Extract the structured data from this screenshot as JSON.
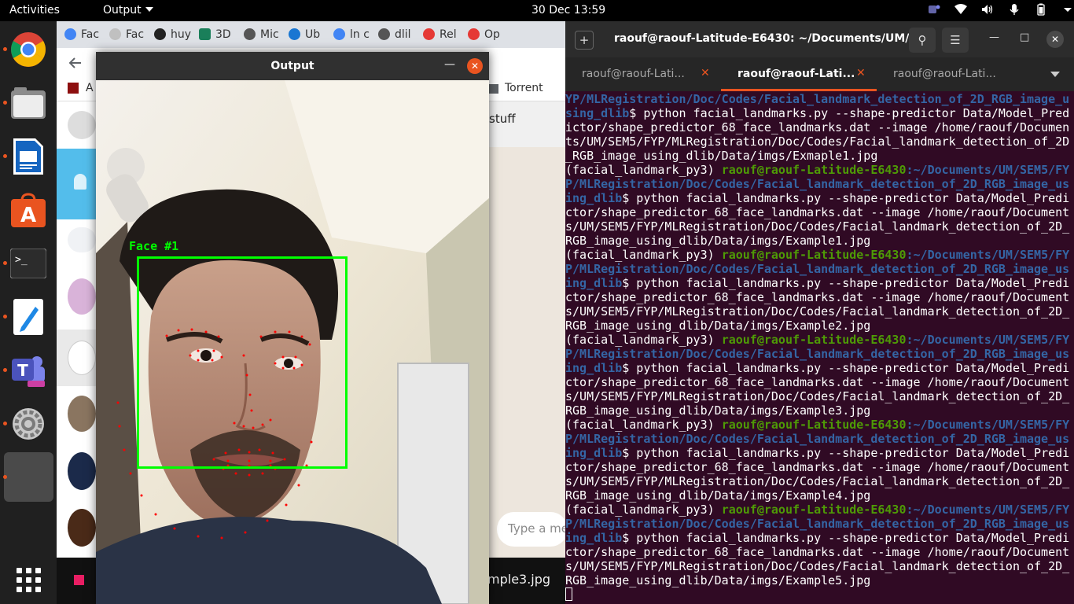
{
  "topbar": {
    "activities": "Activities",
    "app_menu": "Output",
    "clock": "30 Dec  13:59"
  },
  "dock": {
    "items": [
      "chrome-icon",
      "files-icon",
      "writer-icon",
      "software-icon",
      "terminal-icon",
      "teams-icon",
      "text-editor-icon",
      "settings-icon",
      "window-placeholder",
      "apps-grid-icon"
    ]
  },
  "browser": {
    "tabs": [
      "Fac",
      "Fac",
      "huy",
      "3D",
      "Mic",
      "Ub",
      "ln c",
      "dlil",
      "Rel",
      "Op"
    ],
    "bookmark_label": "Torrent",
    "bookmark_left": "A",
    "chat_header_text": "stuff",
    "message_placeholder": "Type a mes",
    "download_name": "mple3.jpg"
  },
  "output_window": {
    "title": "Output",
    "face_label": "Face #1"
  },
  "terminal": {
    "title": "raouf@raouf-Latitude-E6430: ~/Documents/UM/...",
    "tabs": [
      "raouf@raouf-Lati...",
      "raouf@raouf-Lati...",
      "raouf@raouf-Lati..."
    ],
    "lines": [
      {
        "path_cont": "YP/MLRegistration/Doc/Codes/Facial_landmark_detection_of_2D_RGB_image_using_dlib",
        "cmd": "$ python facial_landmarks.py --shape-predictor Data/Model_Predictor/shape_predictor_68_face_landmarks.dat --image /home/raouf/Documents/UM/SEM5/FYP/MLRegistration/Doc/Codes/Facial_landmark_detection_of_2D_RGB_image_using_dlib/Data/imgs/Exmaple1.jpg"
      },
      {
        "env": "(facial_landmark_py3) ",
        "user": "raouf@raouf-Latitude-E6430",
        "path": ":~/Documents/UM/SEM5/FYP/MLRegistration/Doc/Codes/Facial_landmark_detection_of_2D_RGB_image_using_dlib",
        "cmd": "$ python facial_landmarks.py --shape-predictor Data/Model_Predictor/shape_predictor_68_face_landmarks.dat --image /home/raouf/Documents/UM/SEM5/FYP/MLRegistration/Doc/Codes/Facial_landmark_detection_of_2D_RGB_image_using_dlib/Data/imgs/Example1.jpg"
      },
      {
        "env": "(facial_landmark_py3) ",
        "user": "raouf@raouf-Latitude-E6430",
        "path": ":~/Documents/UM/SEM5/FYP/MLRegistration/Doc/Codes/Facial_landmark_detection_of_2D_RGB_image_using_dlib",
        "cmd": "$ python facial_landmarks.py --shape-predictor Data/Model_Predictor/shape_predictor_68_face_landmarks.dat --image /home/raouf/Documents/UM/SEM5/FYP/MLRegistration/Doc/Codes/Facial_landmark_detection_of_2D_RGB_image_using_dlib/Data/imgs/Example2.jpg"
      },
      {
        "env": "(facial_landmark_py3) ",
        "user": "raouf@raouf-Latitude-E6430",
        "path": ":~/Documents/UM/SEM5/FYP/MLRegistration/Doc/Codes/Facial_landmark_detection_of_2D_RGB_image_using_dlib",
        "cmd": "$ python facial_landmarks.py --shape-predictor Data/Model_Predictor/shape_predictor_68_face_landmarks.dat --image /home/raouf/Documents/UM/SEM5/FYP/MLRegistration/Doc/Codes/Facial_landmark_detection_of_2D_RGB_image_using_dlib/Data/imgs/Example3.jpg"
      },
      {
        "env": "(facial_landmark_py3) ",
        "user": "raouf@raouf-Latitude-E6430",
        "path": ":~/Documents/UM/SEM5/FYP/MLRegistration/Doc/Codes/Facial_landmark_detection_of_2D_RGB_image_using_dlib",
        "cmd": "$ python facial_landmarks.py --shape-predictor Data/Model_Predictor/shape_predictor_68_face_landmarks.dat --image /home/raouf/Documents/UM/SEM5/FYP/MLRegistration/Doc/Codes/Facial_landmark_detection_of_2D_RGB_image_using_dlib/Data/imgs/Example4.jpg"
      },
      {
        "env": "(facial_landmark_py3) ",
        "user": "raouf@raouf-Latitude-E6430",
        "path": ":~/Documents/UM/SEM5/FYP/MLRegistration/Doc/Codes/Facial_landmark_detection_of_2D_RGB_image_using_dlib",
        "cmd": "$ python facial_landmarks.py --shape-predictor Data/Model_Predictor/shape_predictor_68_face_landmarks.dat --image /home/raouf/Documents/UM/SEM5/FYP/MLRegistration/Doc/Codes/Facial_landmark_detection_of_2D_RGB_image_using_dlib/Data/imgs/Example5.jpg"
      }
    ]
  },
  "colors": {
    "accent": "#e95420",
    "terminal_bg": "#300a24",
    "prompt_green": "#4e9a06",
    "prompt_blue": "#3465a4",
    "face_box": "#00ff00",
    "landmark": "#ff0000"
  }
}
